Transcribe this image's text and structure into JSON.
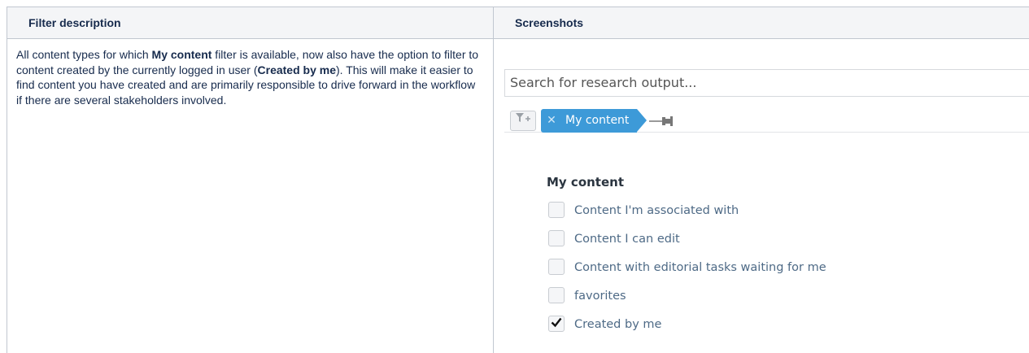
{
  "table": {
    "headers": [
      "Filter description",
      "Screenshots"
    ],
    "description": {
      "t1": "All content types for which ",
      "b1": "My content",
      "t2": " filter is available, now also have the option to filter to content created by the currently logged in user (",
      "b2": "Created by me",
      "t3": "). This will make it easier to find content you have created and are primarily responsible to drive forward in the workflow if there are several stakeholders involved."
    }
  },
  "screenshot": {
    "search_placeholder": "Search for research output...",
    "chip_label": "My content",
    "group_title": "My content",
    "options": [
      {
        "label": "Content I'm associated with",
        "checked": false
      },
      {
        "label": "Content I can edit",
        "checked": false
      },
      {
        "label": "Content with editorial tasks waiting for me",
        "checked": false
      },
      {
        "label": "favorites",
        "checked": false
      },
      {
        "label": "Created by me",
        "checked": true
      }
    ],
    "accent_color": "#3d9ad8",
    "icons": {
      "add_filter": "filter-plus-icon",
      "remove": "close-icon",
      "pin": "pin-icon",
      "check": "checkmark-icon"
    }
  }
}
